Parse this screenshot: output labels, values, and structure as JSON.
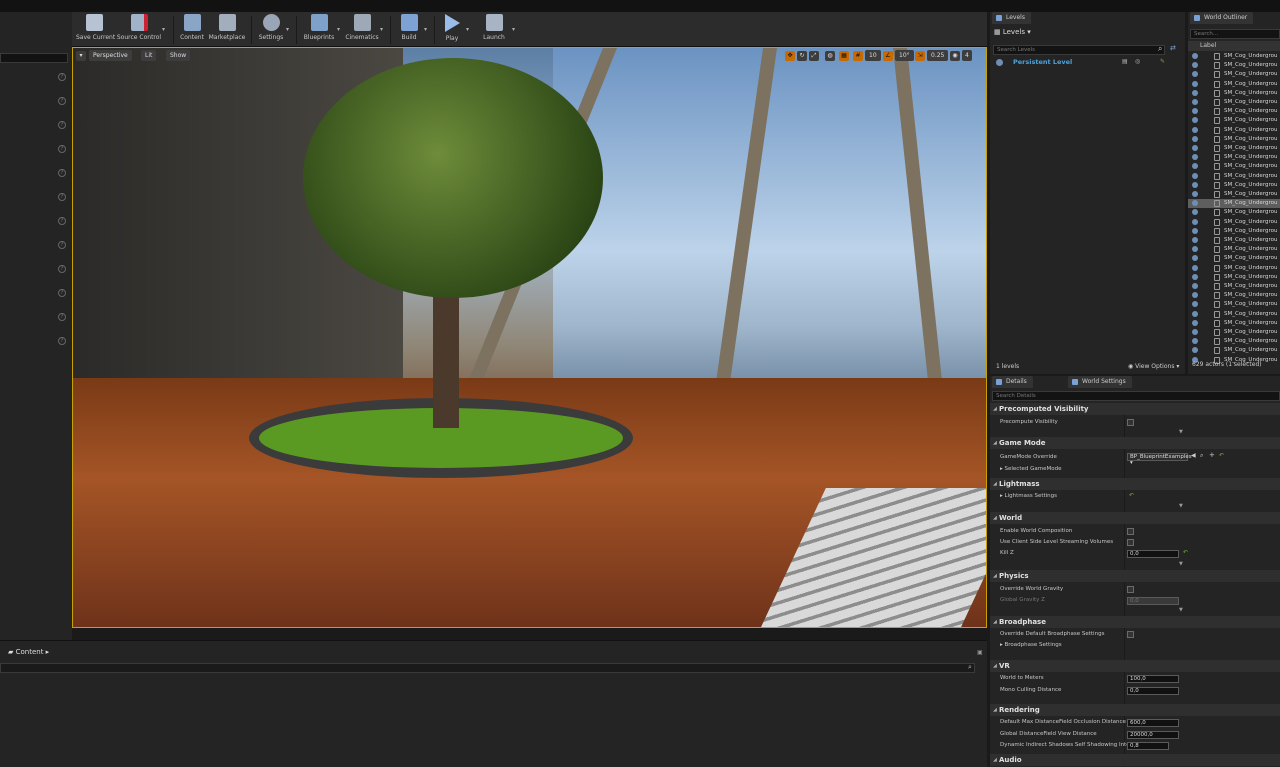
{
  "toolbar": {
    "save_current": "Save Current",
    "source_control": "Source Control",
    "content": "Content",
    "marketplace": "Marketplace",
    "settings": "Settings",
    "blueprints": "Blueprints",
    "cinematics": "Cinematics",
    "build": "Build",
    "play": "Play",
    "launch": "Launch"
  },
  "viewport": {
    "perspective": "Perspective",
    "lit": "Lit",
    "show": "Show",
    "grid_snap": "10",
    "rot_snap": "10°",
    "scale_snap": "0.25",
    "camera_speed": "4"
  },
  "content_browser": {
    "tab_label": "Content"
  },
  "levels": {
    "tab_label": "Levels",
    "header": "Levels",
    "search_placeholder": "Search Levels",
    "persistent_level": "Persistent Level",
    "count": "1 levels",
    "view_options": "View Options"
  },
  "outliner": {
    "tab_label": "World Outliner",
    "search_placeholder": "Search...",
    "column_label": "Label",
    "rows": [
      "SM_Cog_Undergrou",
      "SM_Cog_Undergrou",
      "SM_Cog_Undergrou",
      "SM_Cog_Undergrou",
      "SM_Cog_Undergrou",
      "SM_Cog_Undergrou",
      "SM_Cog_Undergrou",
      "SM_Cog_Undergrou",
      "SM_Cog_Undergrou",
      "SM_Cog_Undergrou",
      "SM_Cog_Undergrou",
      "SM_Cog_Undergrou",
      "SM_Cog_Undergrou",
      "SM_Cog_Undergrou",
      "SM_Cog_Undergrou",
      "SM_Cog_Undergrou",
      "SM_Cog_Undergrou",
      "SM_Cog_Undergrou",
      "SM_Cog_Undergrou",
      "SM_Cog_Undergrou",
      "SM_Cog_Undergrou",
      "SM_Cog_Undergrou",
      "SM_Cog_Undergrou",
      "SM_Cog_Undergrou",
      "SM_Cog_Undergrou",
      "SM_Cog_Undergrou",
      "SM_Cog_Undergrou",
      "SM_Cog_Undergrou",
      "SM_Cog_Undergrou",
      "SM_Cog_Undergrou",
      "SM_Cog_Undergrou",
      "SM_Cog_Undergrou",
      "SM_Cog_Undergrou",
      "SM_Cog_Undergrou"
    ],
    "selected_index": 16,
    "status": "629 actors (1 selected)"
  },
  "details": {
    "tab_details": "Details",
    "tab_world_settings": "World Settings",
    "search_placeholder": "Search Details",
    "precomputed_visibility": "Precomputed Visibility",
    "precompute_visibility": "Precompute Visibility",
    "game_mode": "Game Mode",
    "gamemode_override": "GameMode Override",
    "gamemode_value": "BP_BlueprintExamples",
    "selected_gamemode": "Selected GameMode",
    "lightmass": "Lightmass",
    "lightmass_settings": "Lightmass Settings",
    "world": "World",
    "enable_world_composition": "Enable World Composition",
    "use_client_side": "Use Client Side Level Streaming Volumes",
    "kill_z": "Kill Z",
    "kill_z_value": "0,0",
    "physics": "Physics",
    "override_world_gravity": "Override World Gravity",
    "global_gravity_z": "Global Gravity Z",
    "global_gravity_value": "0,0",
    "broadphase": "Broadphase",
    "override_broadphase": "Override Default Broadphase Settings",
    "broadphase_settings": "Broadphase Settings",
    "vr": "VR",
    "world_to_meters": "World to Meters",
    "world_to_meters_value": "100,0",
    "mono_culling": "Mono Culling Distance",
    "mono_culling_value": "0,0",
    "rendering": "Rendering",
    "default_max_df": "Default Max DistanceField Occlusion Distance",
    "default_max_df_value": "600,0",
    "global_df_view": "Global DistanceField View Distance",
    "global_df_view_value": "20000,0",
    "dynamic_indirect": "Dynamic Indirect Shadows Self Shadowing Intensity",
    "dynamic_indirect_value": "0,8",
    "audio": "Audio"
  },
  "colors": {
    "accent": "#c8a000",
    "selection": "#5e5e5e",
    "link": "#4aa3df"
  }
}
